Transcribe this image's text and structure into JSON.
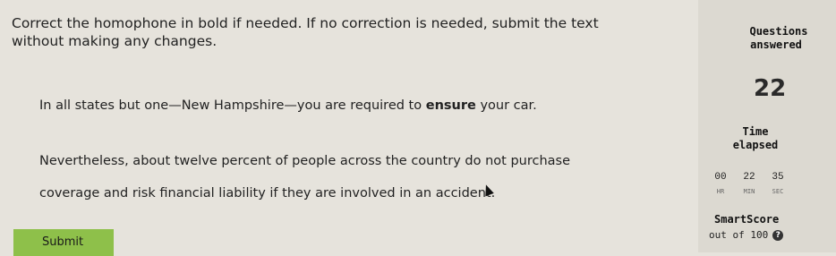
{
  "question": {
    "instructions": "Correct the homophone in bold if needed. If no correction is needed, submit the text without making any changes.",
    "sentence_1_before": "In all states but one—New Hampshire—you are required to ",
    "sentence_1_bold": "ensure",
    "sentence_1_after": " your car.",
    "sentence_2": "Nevertheless, about twelve percent of people across the country do not purchase",
    "sentence_3": "coverage and risk financial liability if they are involved in an accident."
  },
  "submit": {
    "label": "Submit"
  },
  "sidebar": {
    "questions_answered_line1": "Questions",
    "questions_answered_line2": "answered",
    "questions_answered_value": "22",
    "time_elapsed_line1": "Time",
    "time_elapsed_line2": "elapsed",
    "timer": [
      {
        "value": "00",
        "unit": "HR"
      },
      {
        "value": "22",
        "unit": "MIN"
      },
      {
        "value": "35",
        "unit": "SEC"
      }
    ],
    "smartscore_label": "SmartScore",
    "smartscore_sub": "out of 100",
    "help_glyph": "?"
  }
}
